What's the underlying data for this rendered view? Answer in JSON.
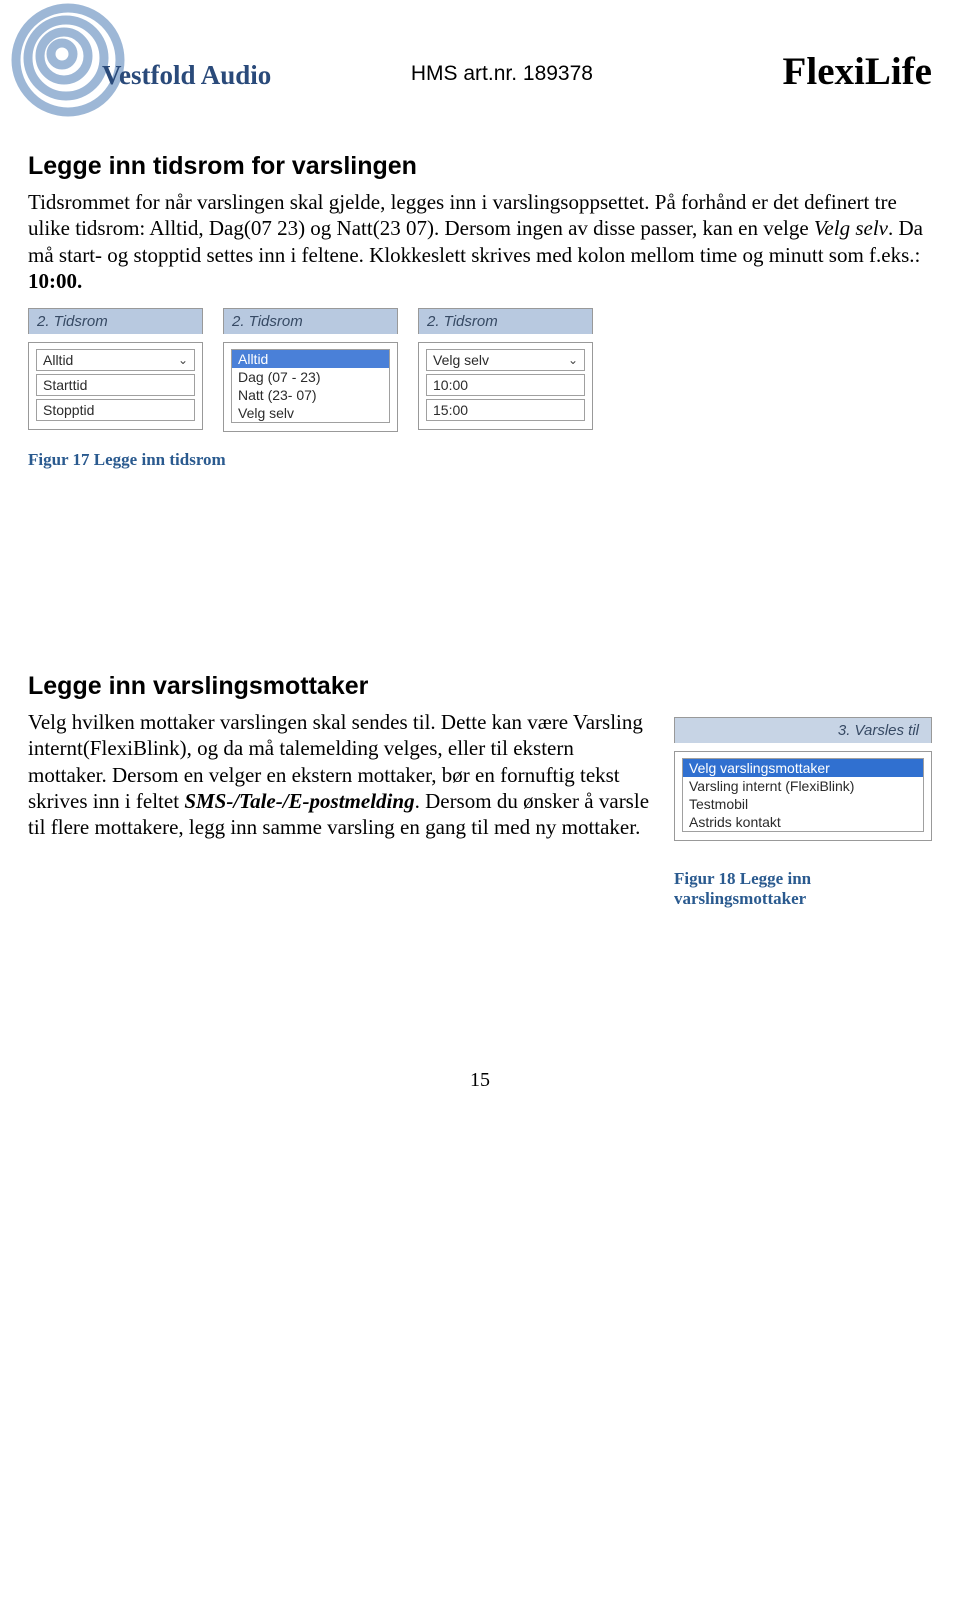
{
  "header": {
    "logo_text": "Vestfold Audio",
    "hms": "HMS art.nr. 189378",
    "brand": "FlexiLife"
  },
  "section1": {
    "title": "Legge inn tidsrom for varslingen",
    "para": "Tidsrommet for når varslingen skal gjelde, legges inn i varslingsoppsettet. På forhånd er det definert tre ulike tidsrom: Alltid, Dag(07 23) og Natt(23 07). Dersom ingen av disse passer, kan en velge ",
    "para_em": "Velg selv",
    "para2": ". Da må start- og stopptid settes inn i feltene. Klokkeslett skrives med kolon mellom time og minutt som f.eks.: ",
    "para2_bold": "10:00.",
    "panels": [
      {
        "head": "2. Tidsrom",
        "type": "cells",
        "rows": [
          "Alltid",
          "Starttid",
          "Stopptid"
        ],
        "dropdown": [
          true,
          false,
          false
        ]
      },
      {
        "head": "2. Tidsrom",
        "type": "list",
        "selected": 0,
        "rows": [
          "Alltid",
          "Dag (07 - 23)",
          "Natt (23- 07)",
          "Velg selv"
        ]
      },
      {
        "head": "2. Tidsrom",
        "type": "cells",
        "rows": [
          "Velg selv",
          "10:00",
          "15:00"
        ],
        "dropdown": [
          true,
          false,
          false
        ]
      }
    ],
    "caption": "Figur 17 Legge inn tidsrom"
  },
  "section2": {
    "title": "Legge inn varslingsmottaker",
    "para": "Velg hvilken mottaker varslingen skal sendes til. Dette kan være Varsling internt(FlexiBlink), og da må talemelding velges, eller til ekstern mottaker. Dersom en velger en ekstern mottaker, bør en fornuftig tekst skrives inn i feltet ",
    "para_em": "SMS-/Tale-/E-postmelding",
    "para2": ". Dersom du ønsker å varsle til flere mottakere, legg inn samme varsling en gang til med ny mottaker.",
    "panel": {
      "head": "3. Varsles til",
      "selected": 0,
      "rows": [
        "Velg varslingsmottaker",
        "Varsling internt (FlexiBlink)",
        "Testmobil",
        "Astrids kontakt"
      ]
    },
    "caption": "Figur 18 Legge inn varslingsmottaker"
  },
  "page_number": "15"
}
